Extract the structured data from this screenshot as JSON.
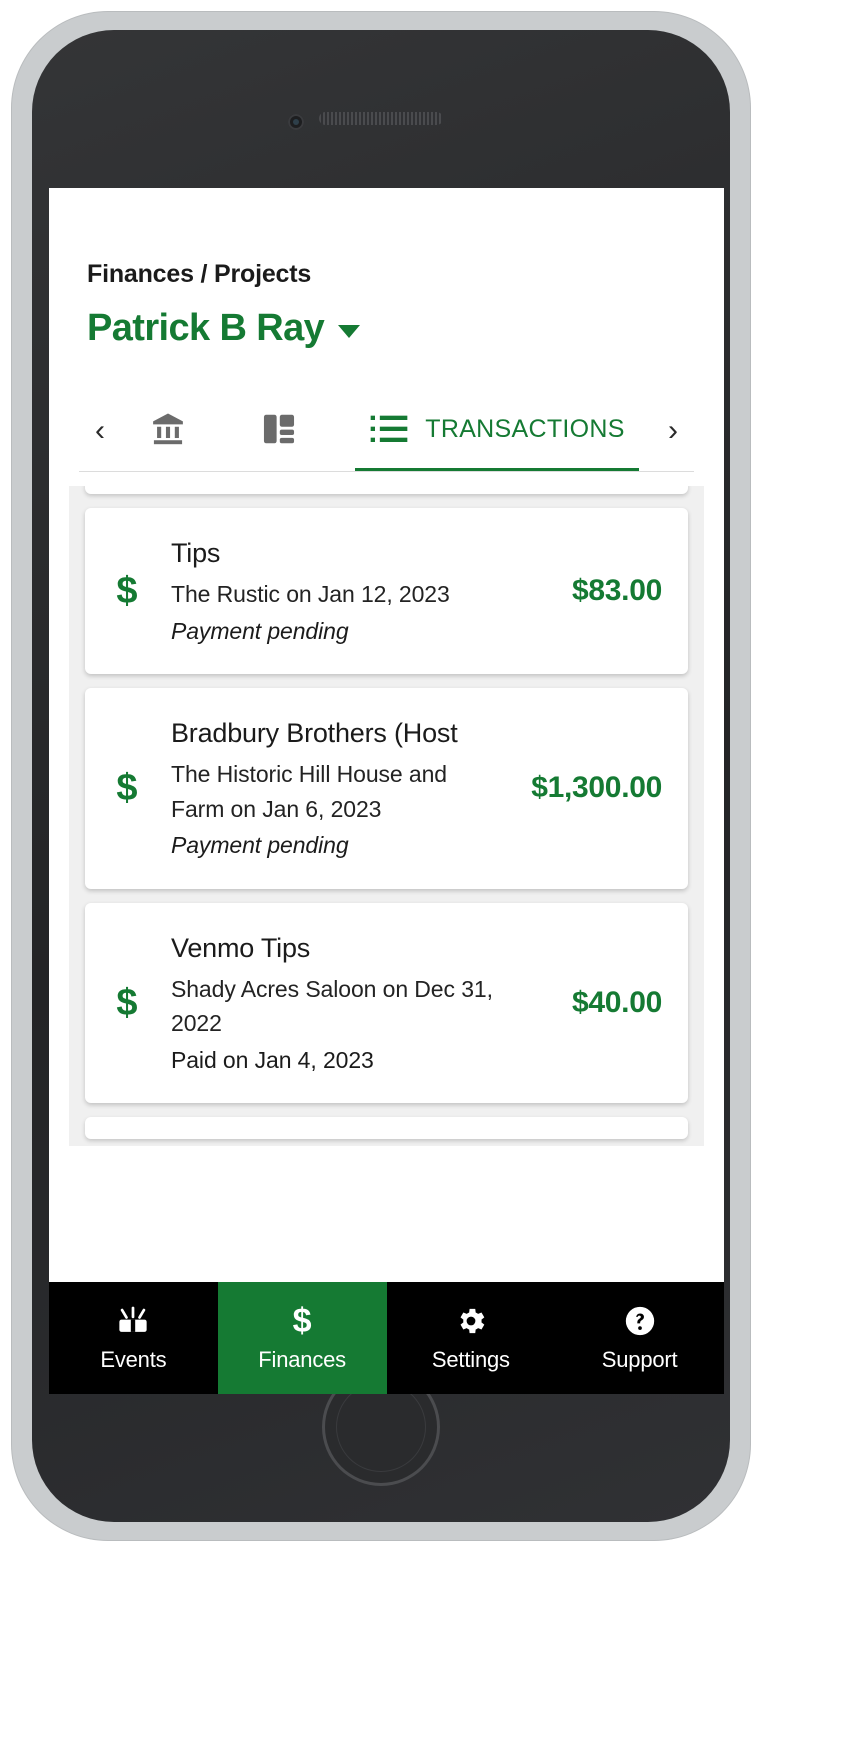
{
  "app": {
    "breadcrumb": "Finances / Projects",
    "account_name": "Patrick B Ray",
    "accent_color": "#157a33",
    "dropdown_icon": "chevron-down-icon"
  },
  "tabstrip": {
    "prev_arrow": "‹",
    "next_arrow": "›",
    "tabs": [
      {
        "id": "accounts",
        "icon": "bank-icon",
        "label": "",
        "active": false
      },
      {
        "id": "overview",
        "icon": "dashboard-grid-icon",
        "label": "",
        "active": false
      },
      {
        "id": "transactions",
        "icon": "list-icon",
        "label": "TRANSACTIONS",
        "active": true
      }
    ]
  },
  "transactions": {
    "items": [
      {
        "icon": "dollar-sign-icon",
        "title": "Tips",
        "subtitle": "The Rustic on Jan 12, 2023",
        "status": "Payment pending",
        "status_style": "pending",
        "amount": "$83.00"
      },
      {
        "icon": "dollar-sign-icon",
        "title": "Bradbury Brothers (Host",
        "subtitle": "The Historic Hill House and Farm on Jan 6, 2023",
        "status": "Payment pending",
        "status_style": "pending",
        "amount": "$1,300.00"
      },
      {
        "icon": "dollar-sign-icon",
        "title": "Venmo Tips",
        "subtitle": "Shady Acres Saloon on Dec 31, 2022",
        "status": "Paid on Jan 4, 2023",
        "status_style": "paid",
        "amount": "$40.00"
      }
    ]
  },
  "bottom_nav": {
    "items": [
      {
        "id": "events",
        "icon": "events-icon",
        "label": "Events",
        "active": false
      },
      {
        "id": "finances",
        "icon": "dollar-sign-icon",
        "label": "Finances",
        "active": true
      },
      {
        "id": "settings",
        "icon": "gear-icon",
        "label": "Settings",
        "active": false
      },
      {
        "id": "support",
        "icon": "question-circle-icon",
        "label": "Support",
        "active": false
      }
    ]
  }
}
